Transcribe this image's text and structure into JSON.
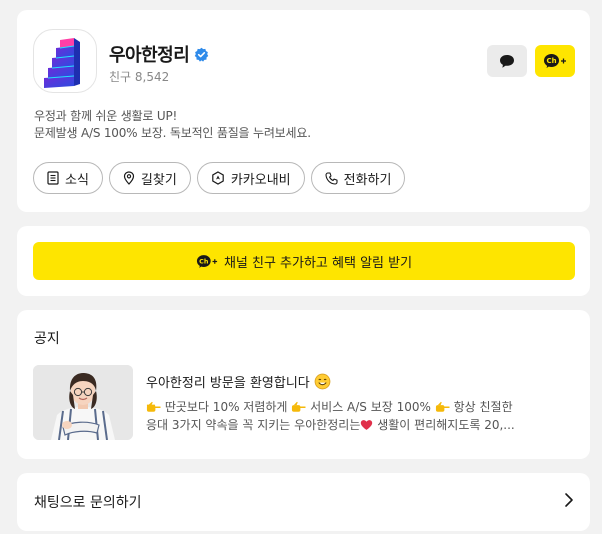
{
  "profile": {
    "name": "우아한정리",
    "friends_label": "친구 8,542",
    "description_line1": "우정과 함께 쉬운 생활로 UP!",
    "description_line2": "문제발생 A/S 100% 보장. 독보적인 품질을 누려보세요.",
    "add_badge_text": "Ch",
    "icons": [
      "stairs-logo-icon",
      "verified-check-icon",
      "chat-bubble-icon",
      "channel-add-icon"
    ]
  },
  "actions": [
    {
      "label": "소식",
      "icon": "news-list-icon"
    },
    {
      "label": "길찾기",
      "icon": "map-pin-icon"
    },
    {
      "label": "카카오내비",
      "icon": "navi-icon"
    },
    {
      "label": "전화하기",
      "icon": "phone-icon"
    }
  ],
  "add_friend": {
    "label": "채널 친구 추가하고 혜택 알림 받기",
    "badge": "Ch"
  },
  "notice": {
    "section_title": "공지",
    "post_title": "우아한정리 방문을 환영합니다",
    "post_body_line1": "딴곳보다 10% 저렴하게  서비스 A/S 보장 100%  항상 친절한",
    "seg1": "딴곳보다 10% 저렴하게",
    "seg2": "서비스 A/S 보장 100%",
    "seg3": "항상 친절한",
    "seg4": "응대 3가지 약속을 꼭 지키는 우아한정리는",
    "seg5": "생활이 편리해지도록 20,..."
  },
  "inquiry": {
    "label": "채팅으로 문의하기"
  },
  "colors": {
    "background": "#f2f2f2",
    "kakao_yellow": "#fee500",
    "verified_blue": "#2f8bea",
    "text_primary": "#191919",
    "text_secondary": "#555555"
  }
}
